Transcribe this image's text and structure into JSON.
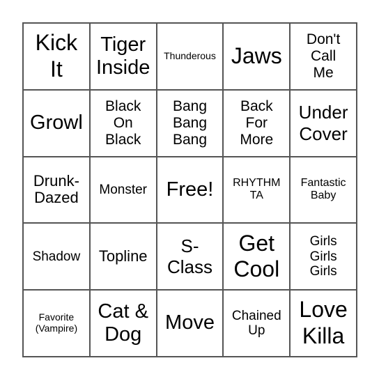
{
  "board": {
    "cells": [
      "Kick\nIt",
      "Tiger\nInside",
      "Thunderous",
      "Jaws",
      "Don't\nCall\nMe",
      "Growl",
      "Black\nOn\nBlack",
      "Bang\nBang\nBang",
      "Back\nFor\nMore",
      "Under\nCover",
      "Drunk-\nDazed",
      "Monster",
      "Free!",
      "RHYTHM\nTA",
      "Fantastic\nBaby",
      "Shadow",
      "Topline",
      "S-\nClass",
      "Get\nCool",
      "Girls\nGirls\nGirls",
      "Favorite\n(Vampire)",
      "Cat &\nDog",
      "Move",
      "Chained\nUp",
      "Love\nKilla"
    ],
    "free_space_index": 12,
    "border_color": "#555555"
  }
}
